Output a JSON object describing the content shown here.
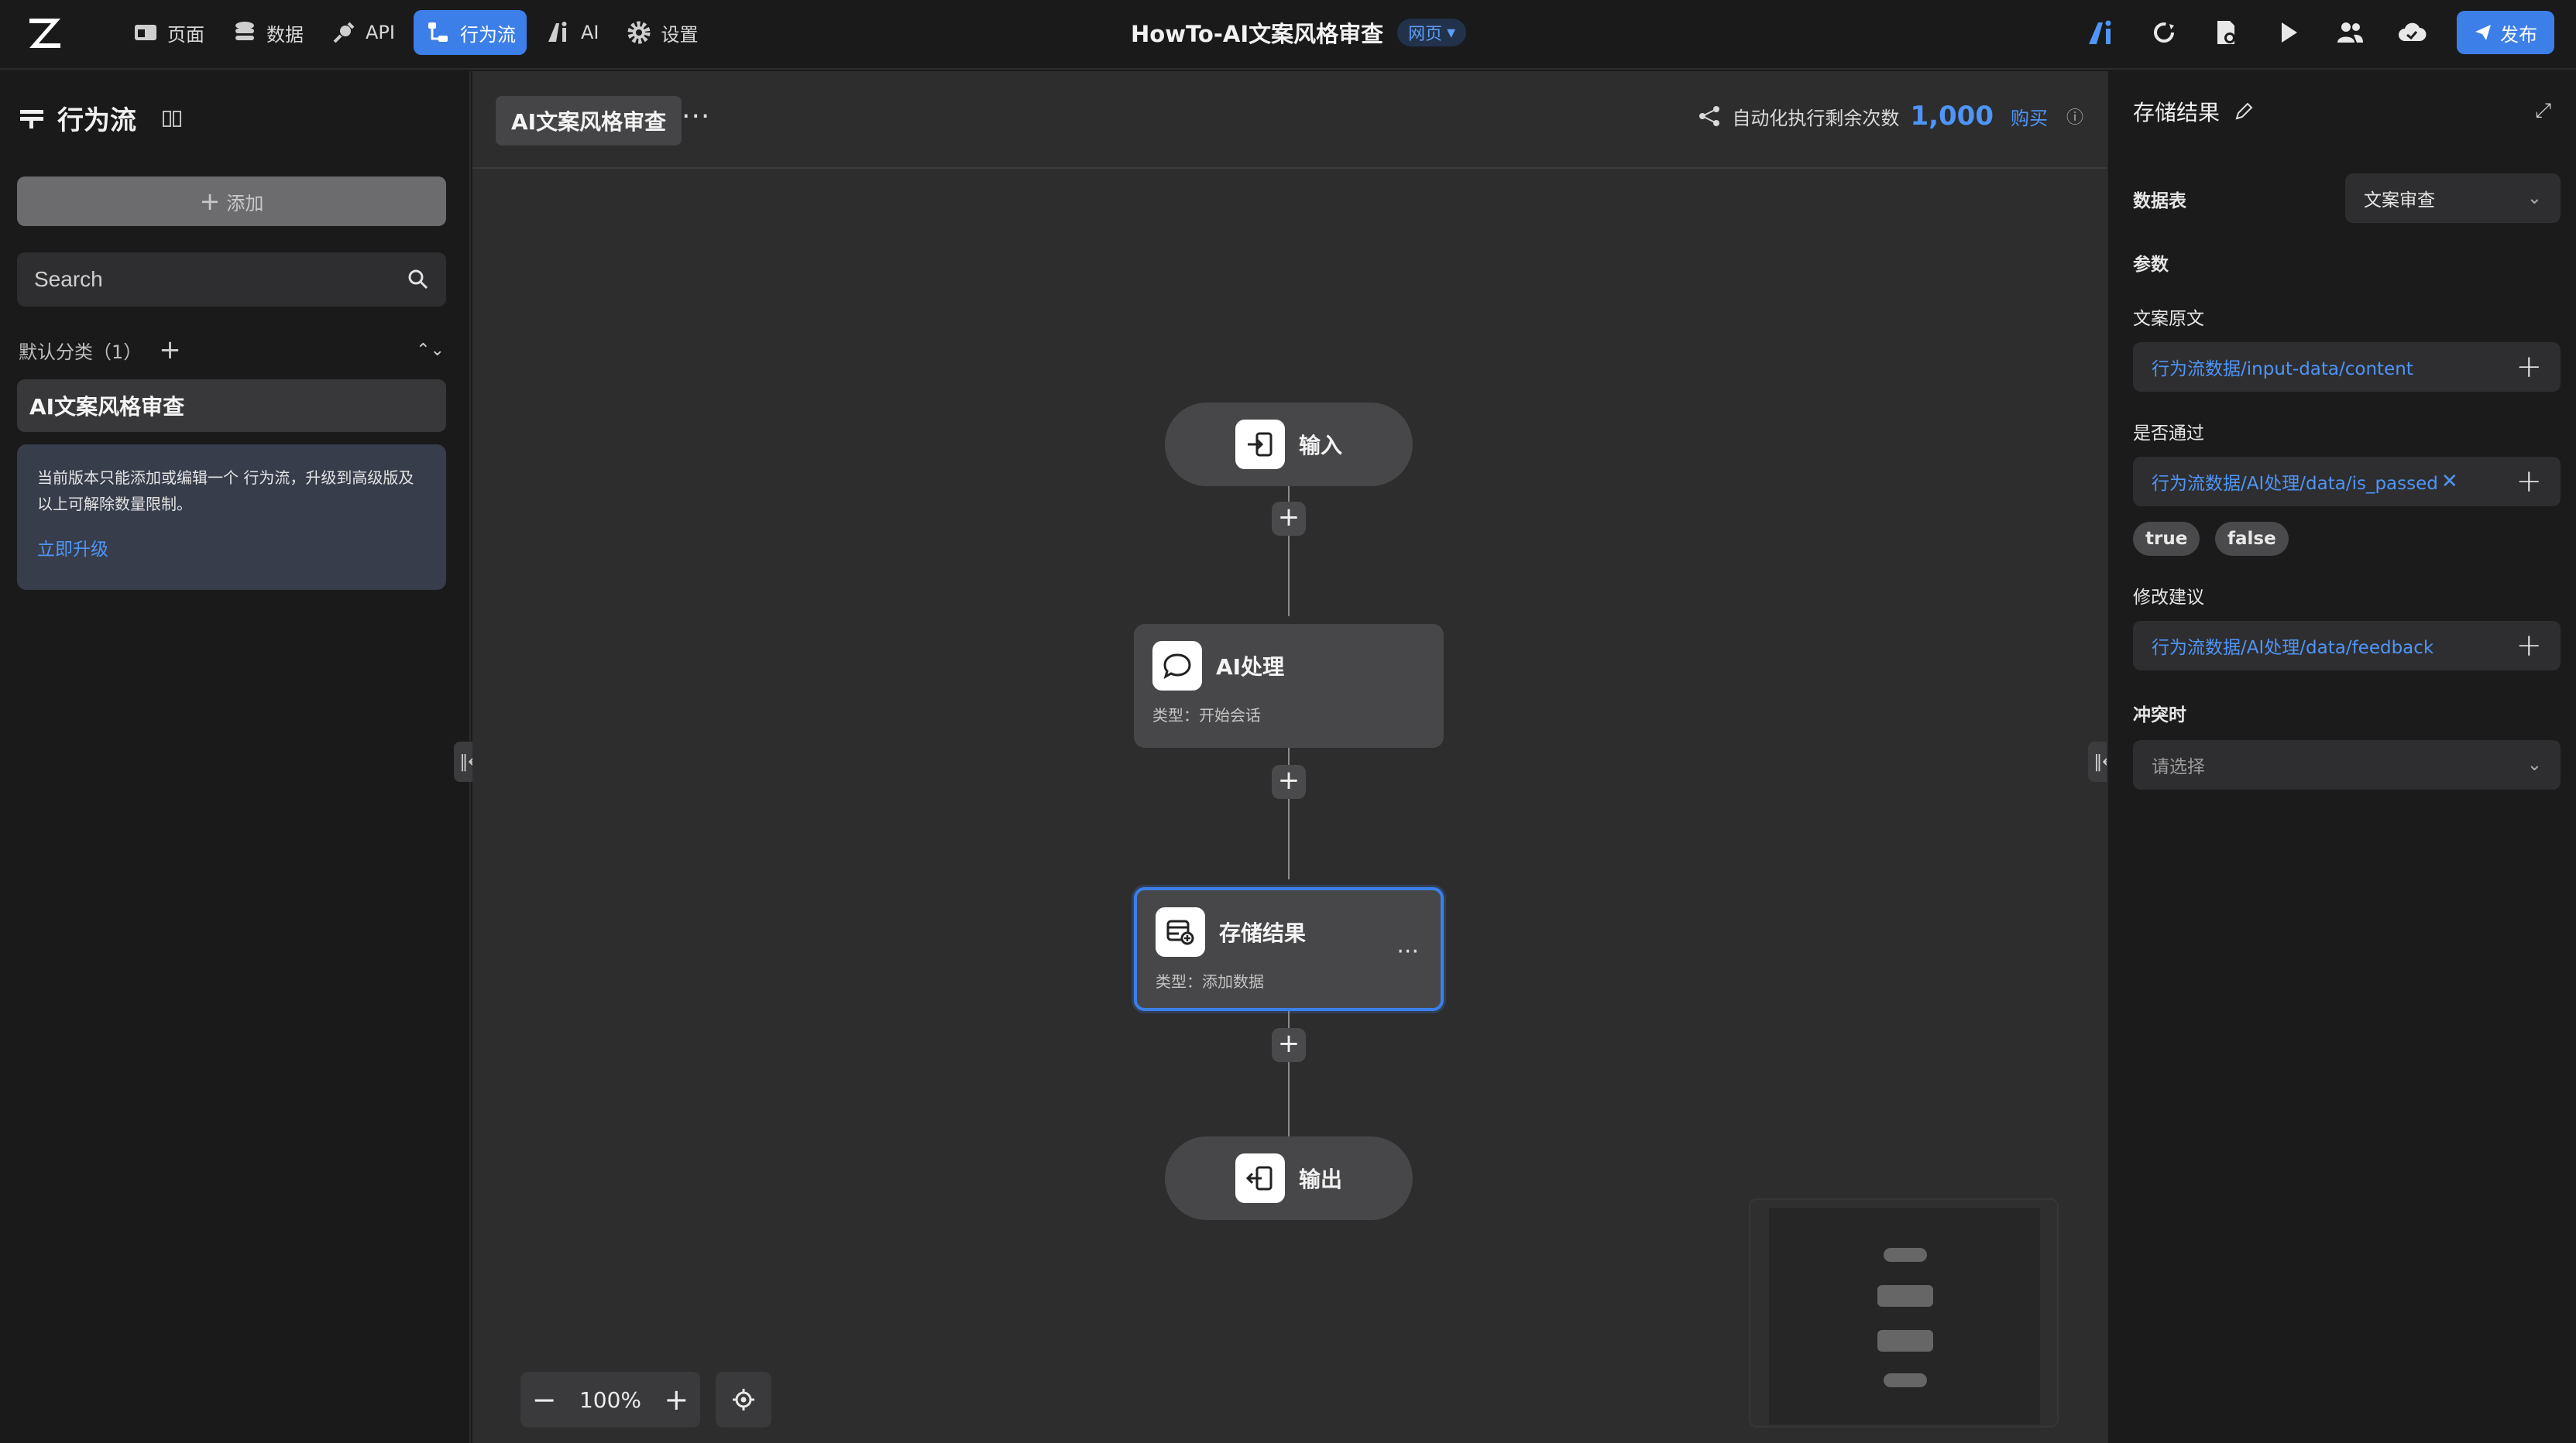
{
  "topbar": {
    "nav": [
      {
        "label": "页面",
        "icon": "pages-icon",
        "active": false
      },
      {
        "label": "数据",
        "icon": "database-icon",
        "active": false
      },
      {
        "label": "API",
        "icon": "api-icon",
        "active": false
      },
      {
        "label": "行为流",
        "icon": "flow-icon",
        "active": true
      },
      {
        "label": "AI",
        "icon": "ai-icon",
        "active": false
      },
      {
        "label": "设置",
        "icon": "gear-icon",
        "active": false
      }
    ],
    "title": "HowTo-AI文案风格审查",
    "badge": "网页",
    "publish_label": "发布",
    "accent": "#3c7fe8"
  },
  "sidebar": {
    "title": "行为流",
    "add_label": "添加",
    "search_placeholder": "Search",
    "category": "默认分类（1）",
    "flow_name": "AI文案风格审查",
    "notice": "当前版本只能添加或编辑一个 行为流，升级到高级版及以上可解除数量限制。",
    "upgrade_label": "立即升级"
  },
  "canvas": {
    "tab": "AI文案风格审查",
    "quota_label": "自动化执行剩余次数",
    "quota_value": "1,000",
    "buy_label": "购买",
    "nodes": {
      "input": {
        "label": "输入"
      },
      "ai": {
        "title": "AI处理",
        "type": "类型：开始会话"
      },
      "store": {
        "title": "存储结果",
        "type": "类型：添加数据"
      },
      "output": {
        "label": "输出"
      }
    },
    "zoom": "100%"
  },
  "panel": {
    "title": "存储结果",
    "table_label": "数据表",
    "table_value": "文案审查",
    "params_label": "参数",
    "fields": [
      {
        "label": "文案原文",
        "value": "行为流数据/input-data/content"
      },
      {
        "label": "是否通过",
        "value": "行为流数据/AI处理/data/is_passed"
      },
      {
        "label": "修改建议",
        "value": "行为流数据/AI处理/data/feedback"
      }
    ],
    "chips": [
      "true",
      "false"
    ],
    "conflict_label": "冲突时",
    "conflict_placeholder": "请选择"
  }
}
